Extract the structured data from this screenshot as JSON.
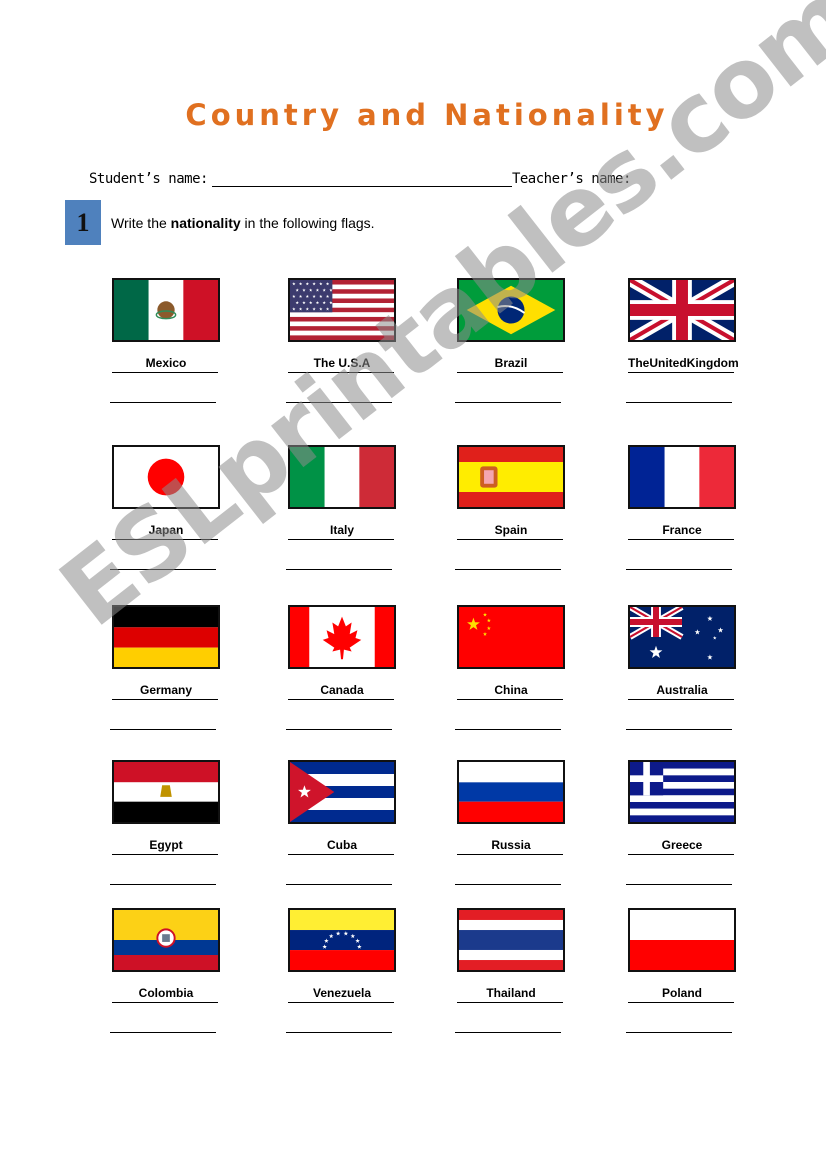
{
  "worksheet": {
    "title": "Country and Nationality",
    "student_label": "Student’s name:",
    "teacher_label": "Teacher’s name:",
    "exercise_number": "1",
    "instruction_before": "Write the ",
    "instruction_bold": "nationality",
    "instruction_after": " in the following flags.",
    "watermark": "ESLprintables.com"
  },
  "countries": [
    {
      "name": "Mexico",
      "flag": "mexico"
    },
    {
      "name": "The U.S.A",
      "flag": "usa"
    },
    {
      "name": "Brazil",
      "flag": "brazil"
    },
    {
      "name": "TheUnitedKingdom",
      "flag": "uk"
    },
    {
      "name": "Japan",
      "flag": "japan"
    },
    {
      "name": "Italy",
      "flag": "italy"
    },
    {
      "name": "Spain",
      "flag": "spain"
    },
    {
      "name": "France",
      "flag": "france"
    },
    {
      "name": "Germany",
      "flag": "germany"
    },
    {
      "name": "Canada",
      "flag": "canada"
    },
    {
      "name": "China",
      "flag": "china"
    },
    {
      "name": "Australia",
      "flag": "australia"
    },
    {
      "name": "Egypt",
      "flag": "egypt"
    },
    {
      "name": "Cuba",
      "flag": "cuba"
    },
    {
      "name": "Russia",
      "flag": "russia"
    },
    {
      "name": "Greece",
      "flag": "greece"
    },
    {
      "name": "Colombia",
      "flag": "colombia"
    },
    {
      "name": "Venezuela",
      "flag": "venezuela"
    },
    {
      "name": "Thailand",
      "flag": "thailand"
    },
    {
      "name": "Poland",
      "flag": "poland"
    }
  ],
  "colors": {
    "title": "#e07020",
    "number_box": "#4f81bd"
  }
}
